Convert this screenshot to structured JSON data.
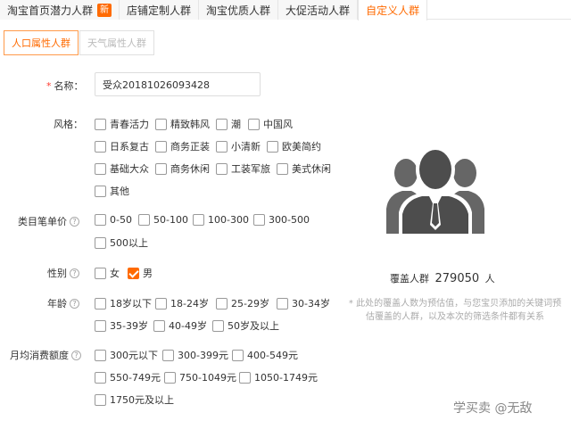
{
  "tabs": [
    {
      "label": "淘宝首页潜力人群",
      "badge": "新"
    },
    {
      "label": "店铺定制人群"
    },
    {
      "label": "淘宝优质人群"
    },
    {
      "label": "大促活动人群"
    },
    {
      "label": "自定义人群",
      "active": true
    }
  ],
  "subtabs": [
    {
      "label": "人口属性人群",
      "active": true
    },
    {
      "label": "天气属性人群"
    }
  ],
  "form": {
    "name_label": "名称：",
    "name_value": "受众20181026093428",
    "style_label": "风格：",
    "category_price_label": "类目笔单价",
    "gender_label": "性别",
    "age_label": "年龄",
    "monthly_spend_label": "月均消费额度"
  },
  "styles": [
    "青春活力",
    "精致韩风",
    "潮",
    "中国风",
    "日系复古",
    "商务正装",
    "小清新",
    "欧美简约",
    "基础大众",
    "商务休闲",
    "工装军旅",
    "美式休闲",
    "其他"
  ],
  "category_prices": [
    "0-50",
    "50-100",
    "100-300",
    "300-500",
    "500以上"
  ],
  "genders": [
    {
      "label": "女",
      "checked": false
    },
    {
      "label": "男",
      "checked": true
    }
  ],
  "ages": [
    "18岁以下",
    "18-24岁",
    "25-29岁",
    "30-34岁",
    "35-39岁",
    "40-49岁",
    "50岁及以上"
  ],
  "monthly_spend": [
    "300元以下",
    "300-399元",
    "400-549元",
    "550-749元",
    "750-1049元",
    "1050-1749元",
    "1750元及以上"
  ],
  "coverage": {
    "prefix": "覆盖人群",
    "value": "279050",
    "unit": "人",
    "note": "* 此处的覆盖人数为预估值，与您宝贝添加的关键词预估覆盖的人群，以及本次的筛选条件都有关系"
  },
  "watermark": "学买卖 @无敌"
}
